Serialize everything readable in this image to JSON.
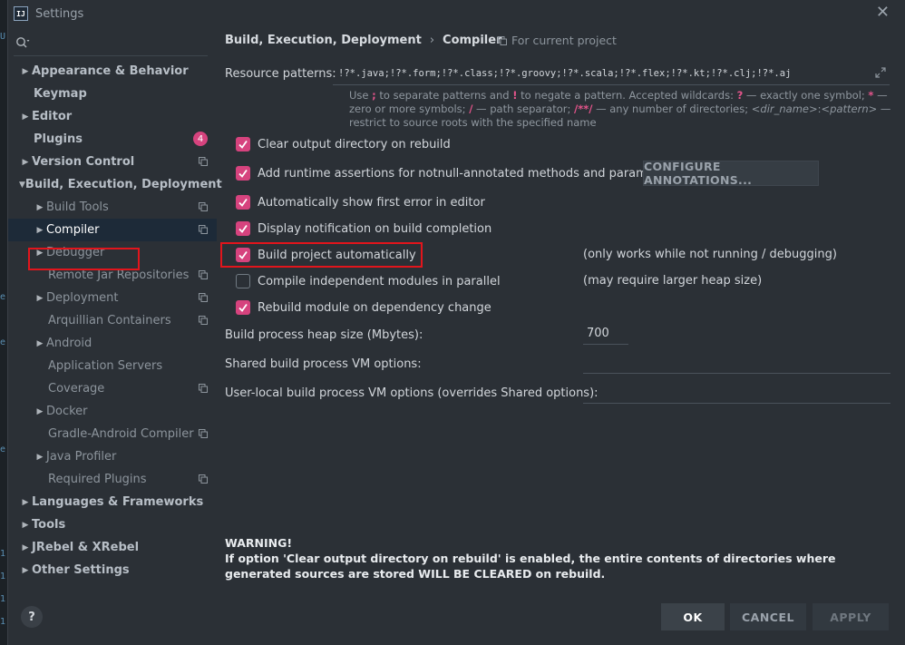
{
  "window": {
    "title": "Settings",
    "app_icon_text": "IJ"
  },
  "search": {
    "placeholder": "",
    "value": ""
  },
  "sidebar": {
    "items": [
      {
        "label": "Appearance & Behavior"
      },
      {
        "label": "Keymap"
      },
      {
        "label": "Editor"
      },
      {
        "label": "Plugins",
        "badge": "4"
      },
      {
        "label": "Version Control"
      },
      {
        "label": "Build, Execution, Deployment"
      },
      {
        "label": "Build Tools"
      },
      {
        "label": "Compiler"
      },
      {
        "label": "Debugger"
      },
      {
        "label": "Remote Jar Repositories"
      },
      {
        "label": "Deployment"
      },
      {
        "label": "Arquillian Containers"
      },
      {
        "label": "Android"
      },
      {
        "label": "Application Servers"
      },
      {
        "label": "Coverage"
      },
      {
        "label": "Docker"
      },
      {
        "label": "Gradle-Android Compiler"
      },
      {
        "label": "Java Profiler"
      },
      {
        "label": "Required Plugins"
      },
      {
        "label": "Languages & Frameworks"
      },
      {
        "label": "Tools"
      },
      {
        "label": "JRebel & XRebel"
      },
      {
        "label": "Other Settings"
      }
    ]
  },
  "breadcrumb": {
    "parent": "Build, Execution, Deployment",
    "sep": "›",
    "current": "Compiler"
  },
  "for_project": "For current project",
  "resource": {
    "label": "Resource patterns:",
    "value": "!?*.java;!?*.form;!?*.class;!?*.groovy;!?*.scala;!?*.flex;!?*.kt;!?*.clj;!?*.aj",
    "hint": {
      "t1": "Use ",
      "k1": ";",
      "t2": " to separate patterns and ",
      "k2": "!",
      "t3": " to negate a pattern. Accepted wildcards: ",
      "k3": "?",
      "t4": " — exactly one symbol; ",
      "k4": "*",
      "t5": " — zero or more symbols; ",
      "k5": "/",
      "t6": " — path separator; ",
      "k6": "/**/",
      "t7": " — any number of directories; ",
      "i1": "<dir_name>",
      "t8": ":",
      "i2": "<pattern>",
      "t9": " — restrict to source roots with the specified name"
    }
  },
  "options": {
    "clear_output": "Clear output directory on rebuild",
    "runtime_assertions": "Add runtime assertions for notnull-annotated methods and parameters",
    "configure_annotations": "CONFIGURE ANNOTATIONS...",
    "show_first_error": "Automatically show first error in editor",
    "display_notification": "Display notification on build completion",
    "build_automatically": "Build project automatically",
    "build_automatically_note": "(only works while not running / debugging)",
    "compile_parallel": "Compile independent modules in parallel",
    "compile_parallel_note": "(may require larger heap size)",
    "rebuild_module": "Rebuild module on dependency change"
  },
  "fields": {
    "heap_label": "Build process heap size (Mbytes):",
    "heap_value": "700",
    "shared_vm_label": "Shared build process VM options:",
    "shared_vm_value": "",
    "user_vm_label": "User-local build process VM options (overrides Shared options):",
    "user_vm_value": ""
  },
  "warning": {
    "title": "WARNING!",
    "text": "If option 'Clear output directory on rebuild' is enabled, the entire contents of directories where generated sources are stored WILL BE CLEARED on rebuild."
  },
  "buttons": {
    "ok": "OK",
    "cancel": "CANCEL",
    "apply": "APPLY",
    "help": "?"
  },
  "colors": {
    "accent": "#d6437e",
    "highlight": "#e2151c",
    "background": "#2b3036",
    "selection": "#1d2a38"
  }
}
